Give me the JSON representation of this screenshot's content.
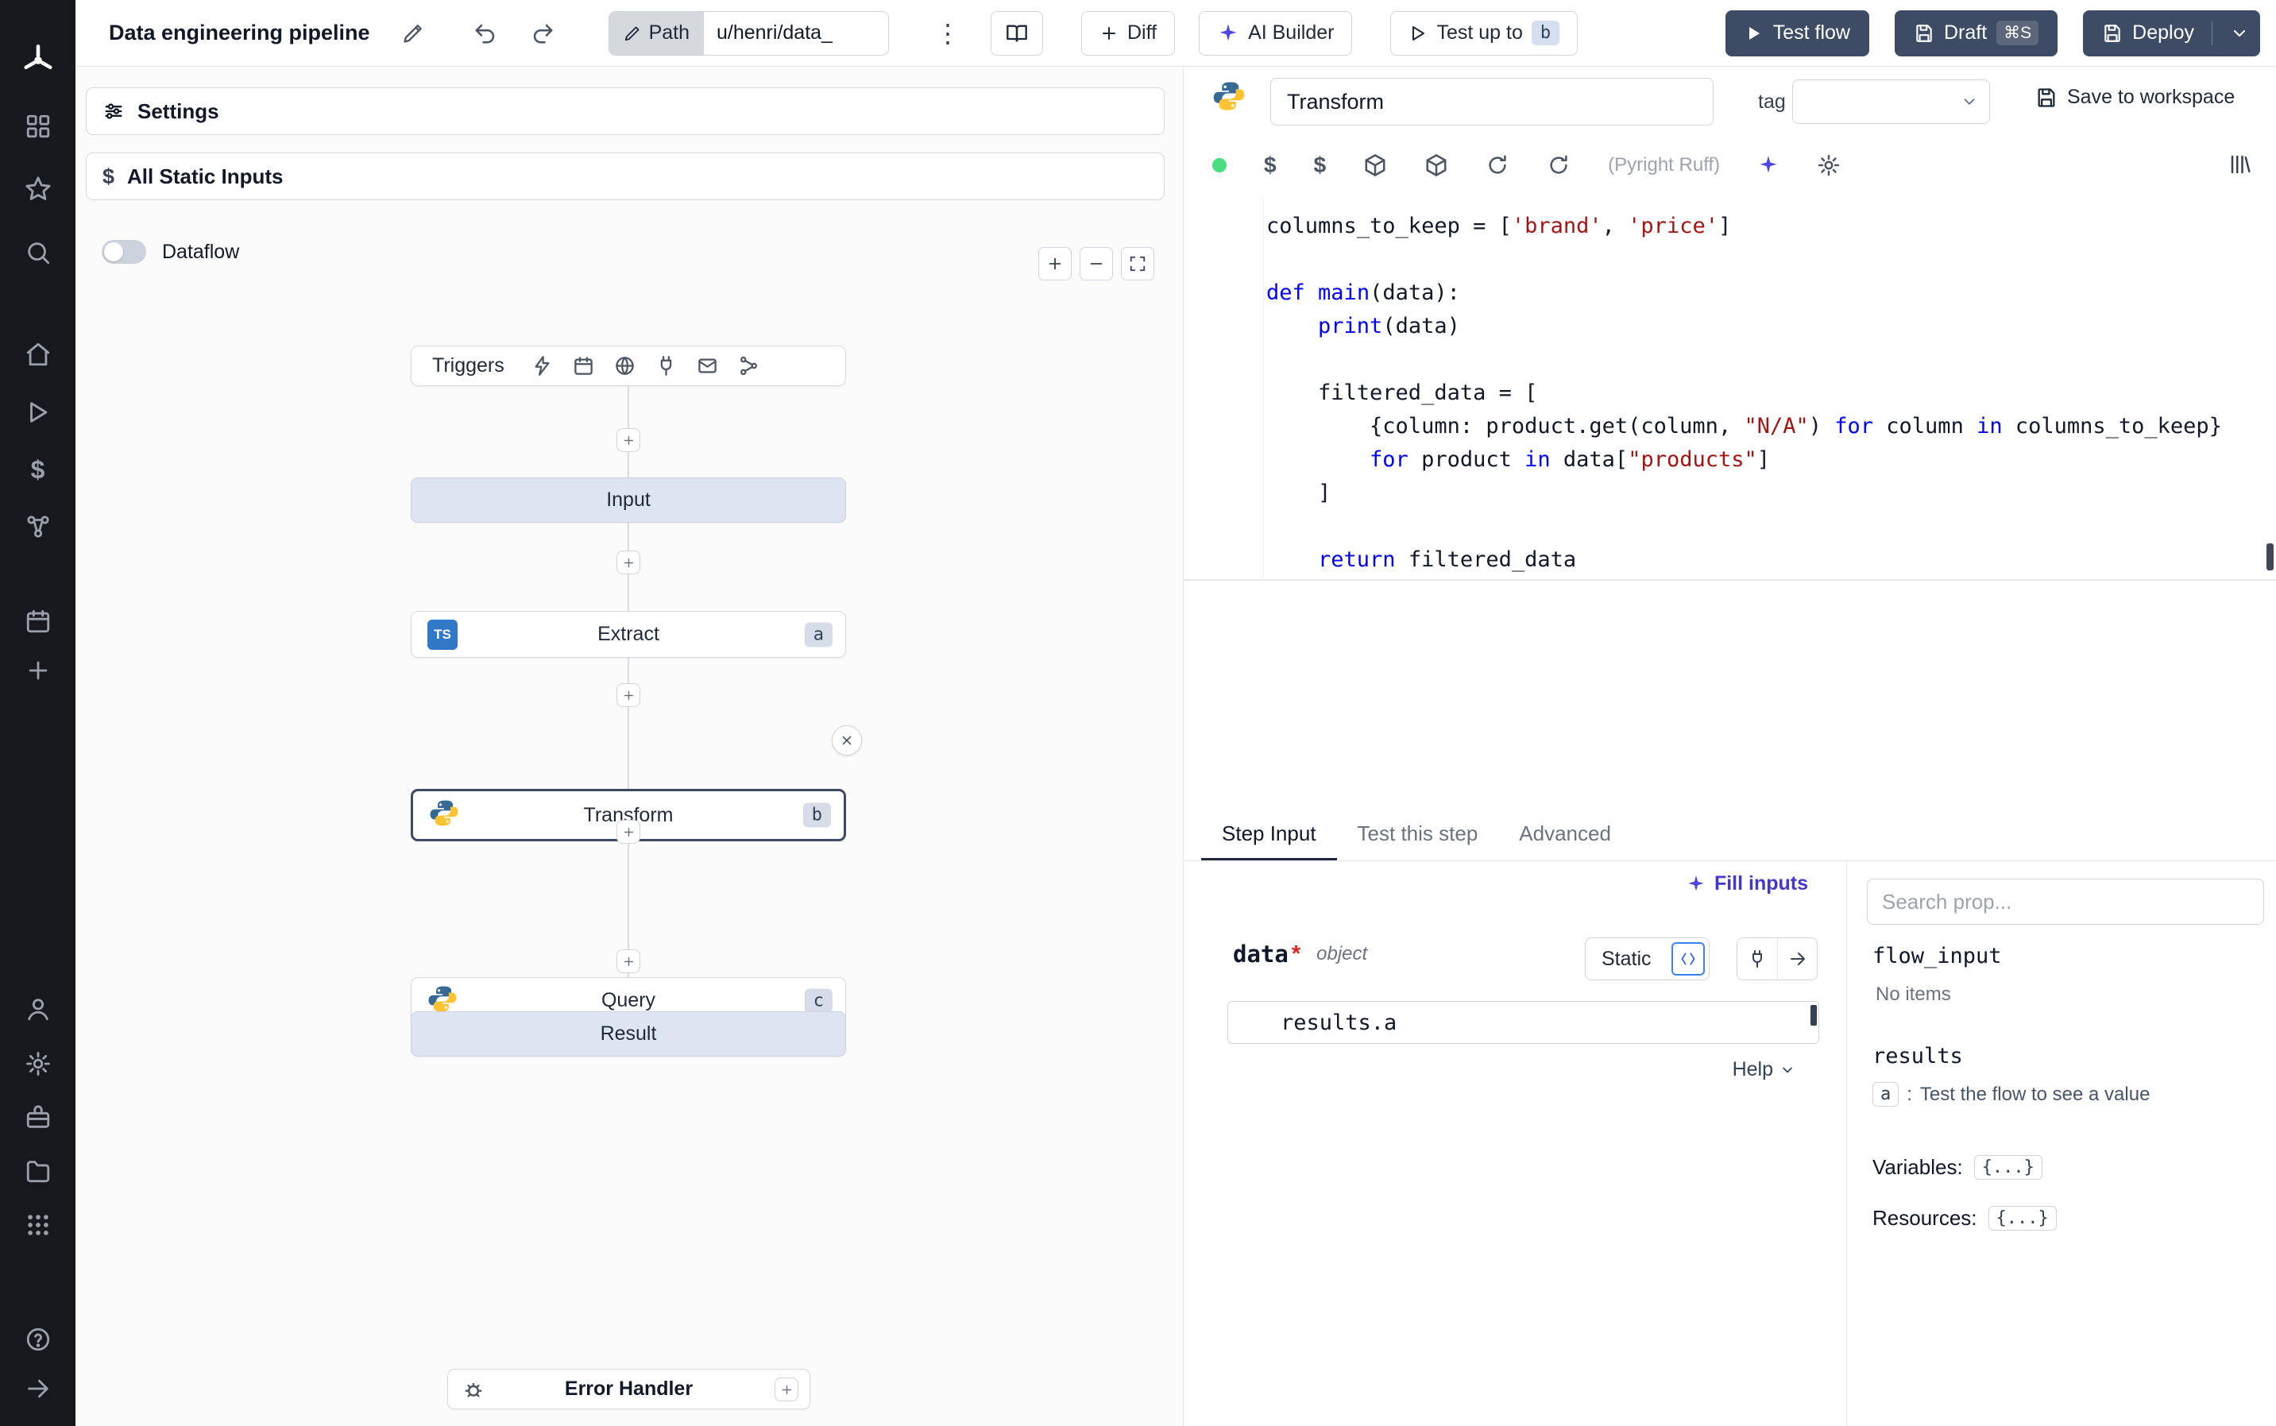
{
  "colors": {
    "sidebar_bg": "#16181d",
    "dark_button": "#3d4b64",
    "selected_node_border": "#3c4a63",
    "ai_accent": "#4f46e5",
    "status_green": "#4ade80",
    "code_keyword": "#0000ff",
    "code_string": "#a31515",
    "io_node_bg": "#dde5f2"
  },
  "topbar": {
    "title": "Data engineering pipeline",
    "path_label": "Path",
    "path_value": "u/henri/data_",
    "diff_label": "Diff",
    "ai_builder_label": "AI Builder",
    "test_up_to_label": "Test up to",
    "test_up_to_badge": "b",
    "test_flow_label": "Test flow",
    "draft_label": "Draft",
    "draft_shortcut": "⌘S",
    "deploy_label": "Deploy"
  },
  "flow": {
    "settings_label": "Settings",
    "static_inputs_label": "All Static Inputs",
    "dataflow_label": "Dataflow",
    "triggers_label": "Triggers",
    "input_label": "Input",
    "extract_label": "Extract",
    "extract_badge": "a",
    "extract_lang": "TS",
    "transform_label": "Transform",
    "transform_badge": "b",
    "query_label": "Query",
    "query_badge": "c",
    "result_label": "Result",
    "error_handler_label": "Error Handler"
  },
  "editor": {
    "step_name": "Transform",
    "tag_label": "tag",
    "save_label": "Save to workspace",
    "lint_label": "(Pyright Ruff)",
    "code_lines": [
      [
        [
          "t",
          "columns_to_keep = ["
        ],
        [
          "s",
          "'brand'"
        ],
        [
          "t",
          ", "
        ],
        [
          "s",
          "'price'"
        ],
        [
          "t",
          "]"
        ]
      ],
      [],
      [
        [
          "k",
          "def"
        ],
        [
          "t",
          " "
        ],
        [
          "k",
          "main"
        ],
        [
          "t",
          "(data):"
        ]
      ],
      [
        [
          "t",
          "    "
        ],
        [
          "k",
          "print"
        ],
        [
          "t",
          "(data)"
        ]
      ],
      [],
      [
        [
          "t",
          "    filtered_data = ["
        ]
      ],
      [
        [
          "t",
          "        {column: product.get(column, "
        ],
        [
          "s",
          "\"N/A\""
        ],
        [
          "t",
          ") "
        ],
        [
          "k",
          "for"
        ],
        [
          "t",
          " column "
        ],
        [
          "k",
          "in"
        ],
        [
          "t",
          " columns_to_keep}"
        ]
      ],
      [
        [
          "t",
          "        "
        ],
        [
          "k",
          "for"
        ],
        [
          "t",
          " product "
        ],
        [
          "k",
          "in"
        ],
        [
          "t",
          " data["
        ],
        [
          "s",
          "\"products\""
        ],
        [
          "t",
          "]"
        ]
      ],
      [
        [
          "t",
          "    ]"
        ]
      ],
      [],
      [
        [
          "t",
          "    "
        ],
        [
          "k",
          "return"
        ],
        [
          "t",
          " filtered_data"
        ]
      ]
    ]
  },
  "tabs": {
    "step_input": "Step Input",
    "test_step": "Test this step",
    "advanced": "Advanced"
  },
  "step_input": {
    "fill_inputs_label": "Fill inputs",
    "field_name": "data",
    "required_mark": "*",
    "field_type": "object",
    "static_label": "Static",
    "field_value": "results.a",
    "help_label": "Help"
  },
  "props": {
    "search_placeholder": "Search prop...",
    "flow_input_label": "flow_input",
    "no_items_label": "No items",
    "results_label": "results",
    "result_key": "a",
    "result_sep": ":",
    "result_hint": "Test the flow to see a value",
    "variables_label": "Variables:",
    "variables_value": "{...}",
    "resources_label": "Resources:",
    "resources_value": "{...}"
  }
}
